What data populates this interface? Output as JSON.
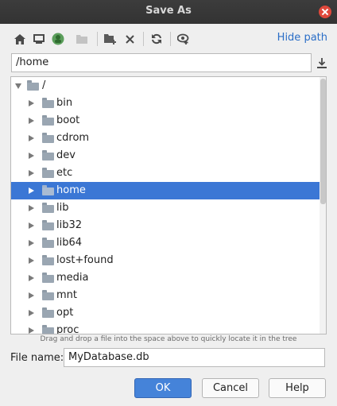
{
  "window": {
    "title": "Save As"
  },
  "toolbar": {
    "icons": [
      "home-icon",
      "desktop-icon",
      "project-icon",
      "new-folder-disabled-icon",
      "new-folder-icon",
      "delete-icon",
      "refresh-icon",
      "show-hidden-icon"
    ],
    "hide_path_label": "Hide path"
  },
  "path": {
    "value": "/home"
  },
  "tree": {
    "root": {
      "label": "/"
    },
    "items": [
      {
        "label": "bin",
        "selected": false
      },
      {
        "label": "boot",
        "selected": false
      },
      {
        "label": "cdrom",
        "selected": false
      },
      {
        "label": "dev",
        "selected": false
      },
      {
        "label": "etc",
        "selected": false
      },
      {
        "label": "home",
        "selected": true
      },
      {
        "label": "lib",
        "selected": false
      },
      {
        "label": "lib32",
        "selected": false
      },
      {
        "label": "lib64",
        "selected": false
      },
      {
        "label": "lost+found",
        "selected": false
      },
      {
        "label": "media",
        "selected": false
      },
      {
        "label": "mnt",
        "selected": false
      },
      {
        "label": "opt",
        "selected": false
      },
      {
        "label": "proc",
        "selected": false
      }
    ]
  },
  "hint": "Drag and drop a file into the space above to quickly locate it in the tree",
  "file_name": {
    "label": "File name:",
    "value": "MyDatabase.db"
  },
  "buttons": {
    "ok": "OK",
    "cancel": "Cancel",
    "help": "Help"
  },
  "colors": {
    "selection": "#3b77d5",
    "link": "#2a6ec7",
    "primary_button": "#4583d9",
    "titlebar": "#353535"
  }
}
